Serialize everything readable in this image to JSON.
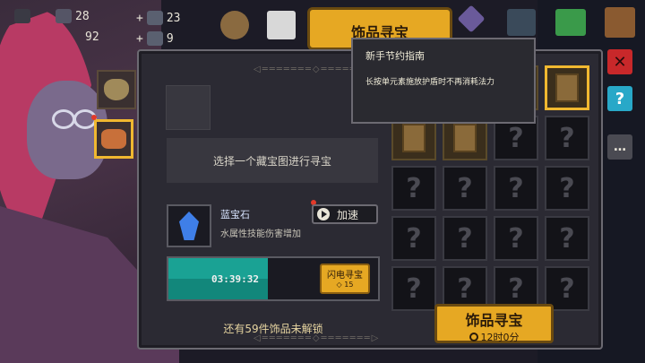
{
  "hud": {
    "value_1": "28",
    "value_2": "92",
    "value_3": "23",
    "value_4": "9"
  },
  "top_tab": {
    "label": "饰品寻宝"
  },
  "tooltip": {
    "title": "新手节约指南",
    "body": "长按单元素施放护盾时不再消耗法力"
  },
  "panel": {
    "select_prompt": "选择一个藏宝图进行寻宝",
    "gem": {
      "name": "蓝宝石",
      "description": "水属性技能伤害增加"
    },
    "speed_button": "加速",
    "progress": {
      "time": "03:39:32",
      "fraction": 0.7
    },
    "flash_button": {
      "label": "闪电寻宝",
      "cost": "15"
    },
    "remaining_text": "还有59件饰品未解锁"
  },
  "grid": {
    "cells": [
      "scroll",
      "scroll",
      "scroll",
      "selected",
      "scroll",
      "scroll",
      "?",
      "?",
      "?",
      "?",
      "?",
      "?",
      "?",
      "?",
      "?",
      "?",
      "?",
      "?",
      "?",
      "?"
    ],
    "unknown_glyph": "?"
  },
  "hunt_button": {
    "title": "饰品寻宝",
    "time": "12时0分"
  },
  "colors": {
    "accent_gold": "#e6a823",
    "progress_teal": "#1aa294",
    "gem_blue": "#3f7fe8",
    "close_red": "#c8282a",
    "help_cyan": "#28a8c8"
  }
}
